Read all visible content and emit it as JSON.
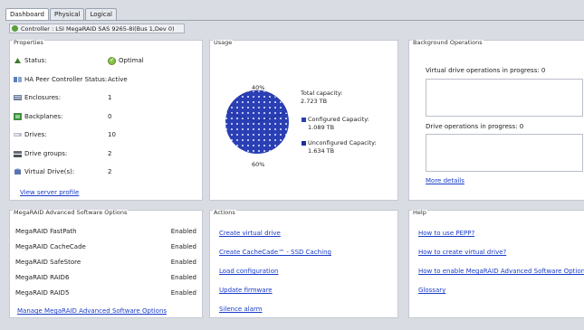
{
  "tabs": [
    {
      "label": "Dashboard",
      "active": true
    },
    {
      "label": "Physical",
      "active": false
    },
    {
      "label": "Logical",
      "active": false
    }
  ],
  "controller": {
    "label": "Controller : LSI MegaRAID SAS 9265-8i(Bus 1,Dev 0)"
  },
  "properties": {
    "title": "Properties",
    "rows": [
      {
        "label": "Status:",
        "value": "Optimal",
        "icon": "status-icon"
      },
      {
        "label": "HA Peer Controller Status:",
        "value": "Active",
        "icon": "ha-peer-icon"
      },
      {
        "label": "Enclosures:",
        "value": "1",
        "icon": "enclosure-icon"
      },
      {
        "label": "Backplanes:",
        "value": "0",
        "icon": "backplane-icon"
      },
      {
        "label": "Drives:",
        "value": "10",
        "icon": "drive-icon"
      },
      {
        "label": "Drive groups:",
        "value": "2",
        "icon": "drive-group-icon"
      },
      {
        "label": "Virtual Drive(s):",
        "value": "2",
        "icon": "virtual-drive-icon"
      }
    ],
    "link": "View server profile"
  },
  "usage": {
    "title": "Usage",
    "top_pct": "40%",
    "bottom_pct": "60%",
    "total_label": "Total capacity:",
    "total_value": "2.723 TB",
    "configured_label": "Configured Capacity:",
    "configured_value": "1.089 TB",
    "unconfigured_label": "Unconfigured Capacity:",
    "unconfigured_value": "1.634 TB",
    "colors": {
      "configured": "#2a3fb4",
      "unconfigured": "#1f2f9e"
    },
    "configured_fraction": 0.4
  },
  "background": {
    "title": "Background Operations",
    "vd_label": "Virtual drive operations in progress: 0",
    "drive_label": "Drive operations in progress: 0",
    "link": "More details"
  },
  "advanced": {
    "title": "MegaRAID Advanced Software Options",
    "rows": [
      {
        "name": "MegaRAID FastPath",
        "state": "Enabled"
      },
      {
        "name": "MegaRAID CacheCade",
        "state": "Enabled"
      },
      {
        "name": "MegaRAID SafeStore",
        "state": "Enabled"
      },
      {
        "name": "MegaRAID RAID6",
        "state": "Enabled"
      },
      {
        "name": "MegaRAID RAID5",
        "state": "Enabled"
      }
    ],
    "link": "Manage MegaRAID Advanced Software Options"
  },
  "actions": {
    "title": "Actions",
    "links": [
      "Create virtual drive",
      "Create CacheCade™ - SSD Caching",
      "Load configuration",
      "Update firmware",
      "Silence alarm"
    ]
  },
  "help": {
    "title": "Help",
    "links": [
      "How to use PEPP?",
      "How to create virtual drive?",
      "How to enable MegaRAID Advanced Software Options?",
      "Glossary"
    ]
  }
}
